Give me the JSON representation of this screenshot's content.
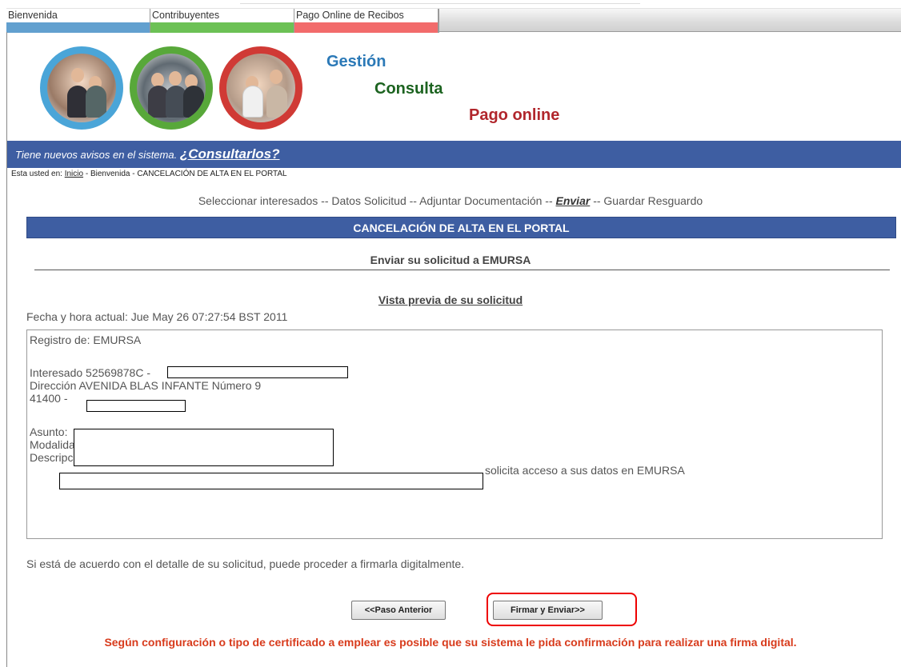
{
  "tabs": [
    {
      "label": "Bienvenida",
      "color": "#62a0cf"
    },
    {
      "label": "Contribuyentes",
      "color": "#6cc155"
    },
    {
      "label": "Pago Online de Recibos",
      "color": "#f26b6b"
    }
  ],
  "header": {
    "line1": "Gestión",
    "line2": "Consulta",
    "line3": "Pago online",
    "colors": [
      "#2b79b7",
      "#1c6320",
      "#b1262c"
    ]
  },
  "notice": {
    "text": "Tiene nuevos avisos en el sistema.",
    "link": "¿Consultarlos?"
  },
  "breadcrumb": {
    "prefix": "Esta usted en:",
    "home": "Inicio",
    "rest": "- Bienvenida - CANCELACIÓN DE ALTA EN EL PORTAL"
  },
  "steps": {
    "before": "Seleccionar interesados -- Datos Solicitud -- Adjuntar Documentación --",
    "current": "Enviar",
    "after": "-- Guardar Resguardo"
  },
  "section_title": "CANCELACIÓN DE ALTA EN EL PORTAL",
  "subtitle": "Enviar su solicitud a EMURSA",
  "preview_title": "Vista previa de su solicitud",
  "datetime": "Fecha y hora actual: Jue May 26 07:27:54 BST 2011",
  "preview": {
    "registro": "Registro de: EMURSA",
    "interesado": "Interesado 52569878C -",
    "direccion": "Dirección AVENIDA BLAS INFANTE Número 9",
    "cp": "41400 -",
    "asunto": "Asunto:",
    "modalidad": "Modalida",
    "descripcion": "Descripción:",
    "solicita": "solicita acceso a sus datos en EMURSA"
  },
  "agree_text": "Si está de acuerdo con el detalle de su solicitud, puede proceder a firmarla digitalmente.",
  "buttons": {
    "prev": "<<Paso Anterior",
    "sign": "Firmar y Enviar>>"
  },
  "warning": "Según configuración o tipo de certificado a emplear es posible que su sistema le pida confirmación para realizar una firma digital."
}
